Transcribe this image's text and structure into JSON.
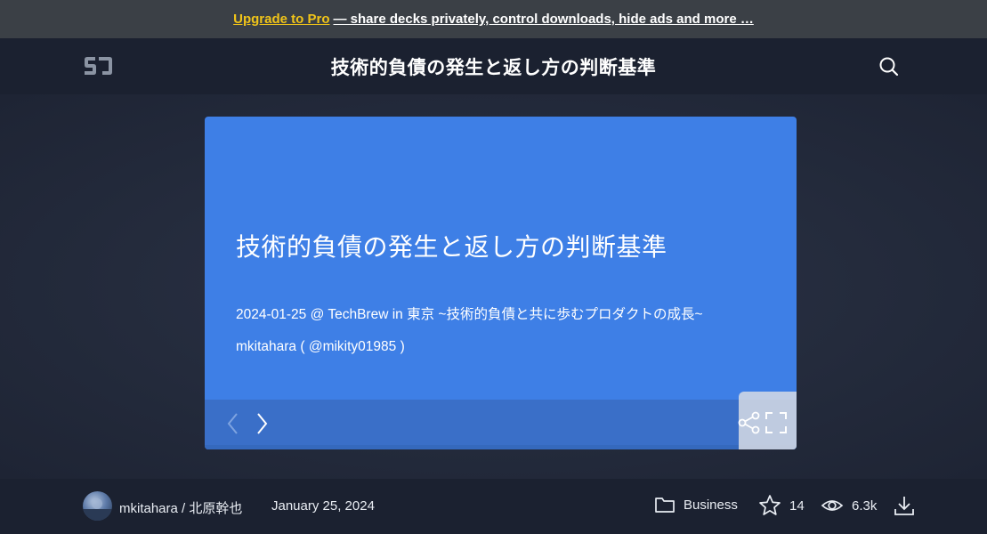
{
  "promo": {
    "link_label": "Upgrade to Pro",
    "text": "— share decks privately, control downloads, hide ads and more …"
  },
  "header": {
    "logo_icon": "speakerdeck-logo-icon",
    "title": "技術的負債の発生と返し方の判断基準",
    "search_icon": "search-icon"
  },
  "slide": {
    "title": "技術的負債の発生と返し方の判断基準",
    "subtitle": "2024-01-25 @ TechBrew in 東京 ~技術的負債と共に歩むプロダクトの成長~",
    "author": "mkitahara ( @mikity01985 )",
    "background_color": "#3e7fe6",
    "controls": {
      "prev_icon": "chevron-left-icon",
      "next_icon": "chevron-right-icon",
      "share_icon": "share-icon",
      "fullscreen_icon": "fullscreen-icon"
    }
  },
  "footer": {
    "author": "mkitahara / 北原幹也",
    "date": "January 25, 2024",
    "category": "Business",
    "stars": "14",
    "views": "6.3k",
    "download_icon": "download-icon"
  },
  "colors": {
    "promo_link": "#f0c419",
    "background": "#1f2533",
    "slide_bg": "#3e7fe6"
  }
}
